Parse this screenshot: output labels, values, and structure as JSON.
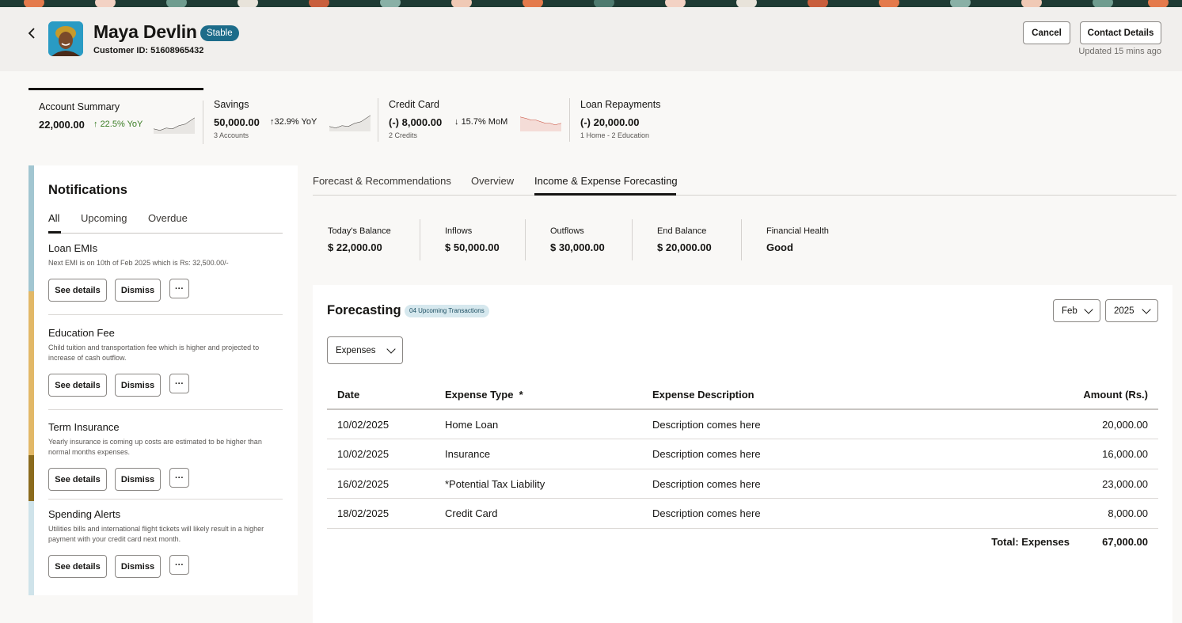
{
  "customer": {
    "name": "Maya Devlin",
    "status": "Stable",
    "id_label": "Customer ID: 51608965432",
    "updated": "Updated 15 mins ago"
  },
  "header_actions": {
    "cancel": "Cancel",
    "contact": "Contact Details"
  },
  "summary_cards": [
    {
      "label": "Account Summary",
      "value": "22,000.00",
      "trend": "22.5% YoY",
      "trend_dir": "up",
      "trend_color": "#3a7d24",
      "sub": "",
      "spark_color": "#3a3734"
    },
    {
      "label": "Savings",
      "value": "50,000.00",
      "trend": "32.9% YoY",
      "trend_dir": "up",
      "trend_color": "#161513",
      "sub": "3 Accounts",
      "spark_color": "#3a3734"
    },
    {
      "label": "Credit Card",
      "value": "(-) 8,000.00",
      "trend": "15.7% MoM",
      "trend_dir": "down",
      "trend_color": "#161513",
      "sub": "2 Credits",
      "spark_color": "#c74634"
    },
    {
      "label": "Loan Repayments",
      "value": "(-) 20,000.00",
      "trend": "",
      "trend_dir": "",
      "trend_color": "#161513",
      "sub": "1 Home - 2 Education",
      "spark_color": ""
    }
  ],
  "notifications": {
    "title": "Notifications",
    "tabs": [
      "All",
      "Upcoming",
      "Overdue"
    ],
    "active_tab": "All",
    "items": [
      {
        "title": "Loan EMIs",
        "desc": "Next EMI is on 10th of Feb 2025 which is Rs: 32,500.00/-",
        "strip_color": "#a2c6d1"
      },
      {
        "title": "Education Fee",
        "desc": "Child tuition and transportation fee which is higher and projected to increase of cash outflow.",
        "strip_color": "#e2b867"
      },
      {
        "title": "Term Insurance",
        "desc": "Yearly insurance is coming up costs are estimated to be higher than normal months expenses.",
        "strip_color": "#8b6b1e"
      },
      {
        "title": "Spending Alerts",
        "desc": "Utilities bills and international flight tickets will likely result in a higher payment with your credit card next month.",
        "strip_color": "#cfe3ea"
      }
    ],
    "see_details": "See details",
    "dismiss": "Dismiss",
    "more": "···"
  },
  "main_tabs": [
    "Forecast & Recommendations",
    "Overview",
    "Income & Expense Forecasting"
  ],
  "active_main_tab": "Income & Expense Forecasting",
  "metrics": [
    {
      "label": "Today's Balance",
      "value": "$ 22,000.00"
    },
    {
      "label": "Inflows",
      "value": "$ 50,000.00"
    },
    {
      "label": "Outflows",
      "value": "$ 30,000.00"
    },
    {
      "label": "End Balance",
      "value": "$ 20,000.00"
    },
    {
      "label": "Financial Health",
      "value": "Good"
    }
  ],
  "forecasting": {
    "title": "Forecasting",
    "badge": "04 Upcoming Transactions",
    "month": "Feb",
    "year": "2025",
    "type": "Expenses",
    "columns": [
      "Date",
      "Expense Type  *",
      "Expense Description",
      "Amount (Rs.)"
    ],
    "rows": [
      [
        "10/02/2025",
        "Home Loan",
        "Description comes here",
        "20,000.00"
      ],
      [
        "10/02/2025",
        "Insurance",
        "Description comes here",
        "16,000.00"
      ],
      [
        "16/02/2025",
        "*Potential Tax Liability",
        "Description comes here",
        "23,000.00"
      ],
      [
        "18/02/2025",
        "Credit Card",
        "Description comes here",
        "8,000.00"
      ]
    ],
    "total_label": "Total: Expenses",
    "total_value": "67,000.00"
  }
}
